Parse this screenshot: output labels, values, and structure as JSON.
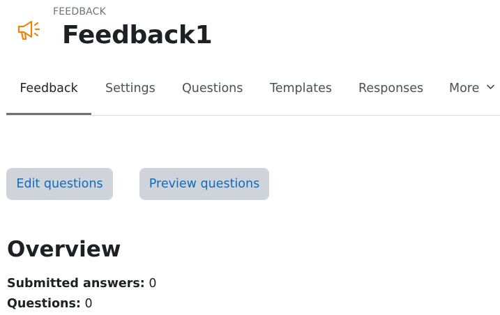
{
  "header": {
    "module_type": "FEEDBACK",
    "title": "Feedback1",
    "icon": "megaphone-icon",
    "icon_color": "#f0820a"
  },
  "tabs": [
    {
      "label": "Feedback",
      "active": true
    },
    {
      "label": "Settings",
      "active": false
    },
    {
      "label": "Questions",
      "active": false
    },
    {
      "label": "Templates",
      "active": false
    },
    {
      "label": "Responses",
      "active": false
    },
    {
      "label": "More",
      "active": false
    }
  ],
  "actions": {
    "edit_label": "Edit questions",
    "preview_label": "Preview questions"
  },
  "overview": {
    "title": "Overview",
    "submitted_label": "Submitted answers:",
    "submitted_value": "0",
    "questions_label": "Questions:",
    "questions_value": "0"
  },
  "colors": {
    "button_bg": "#ced4da",
    "link": "#0f6cbf",
    "active_tab_underline": "#6a737b"
  }
}
